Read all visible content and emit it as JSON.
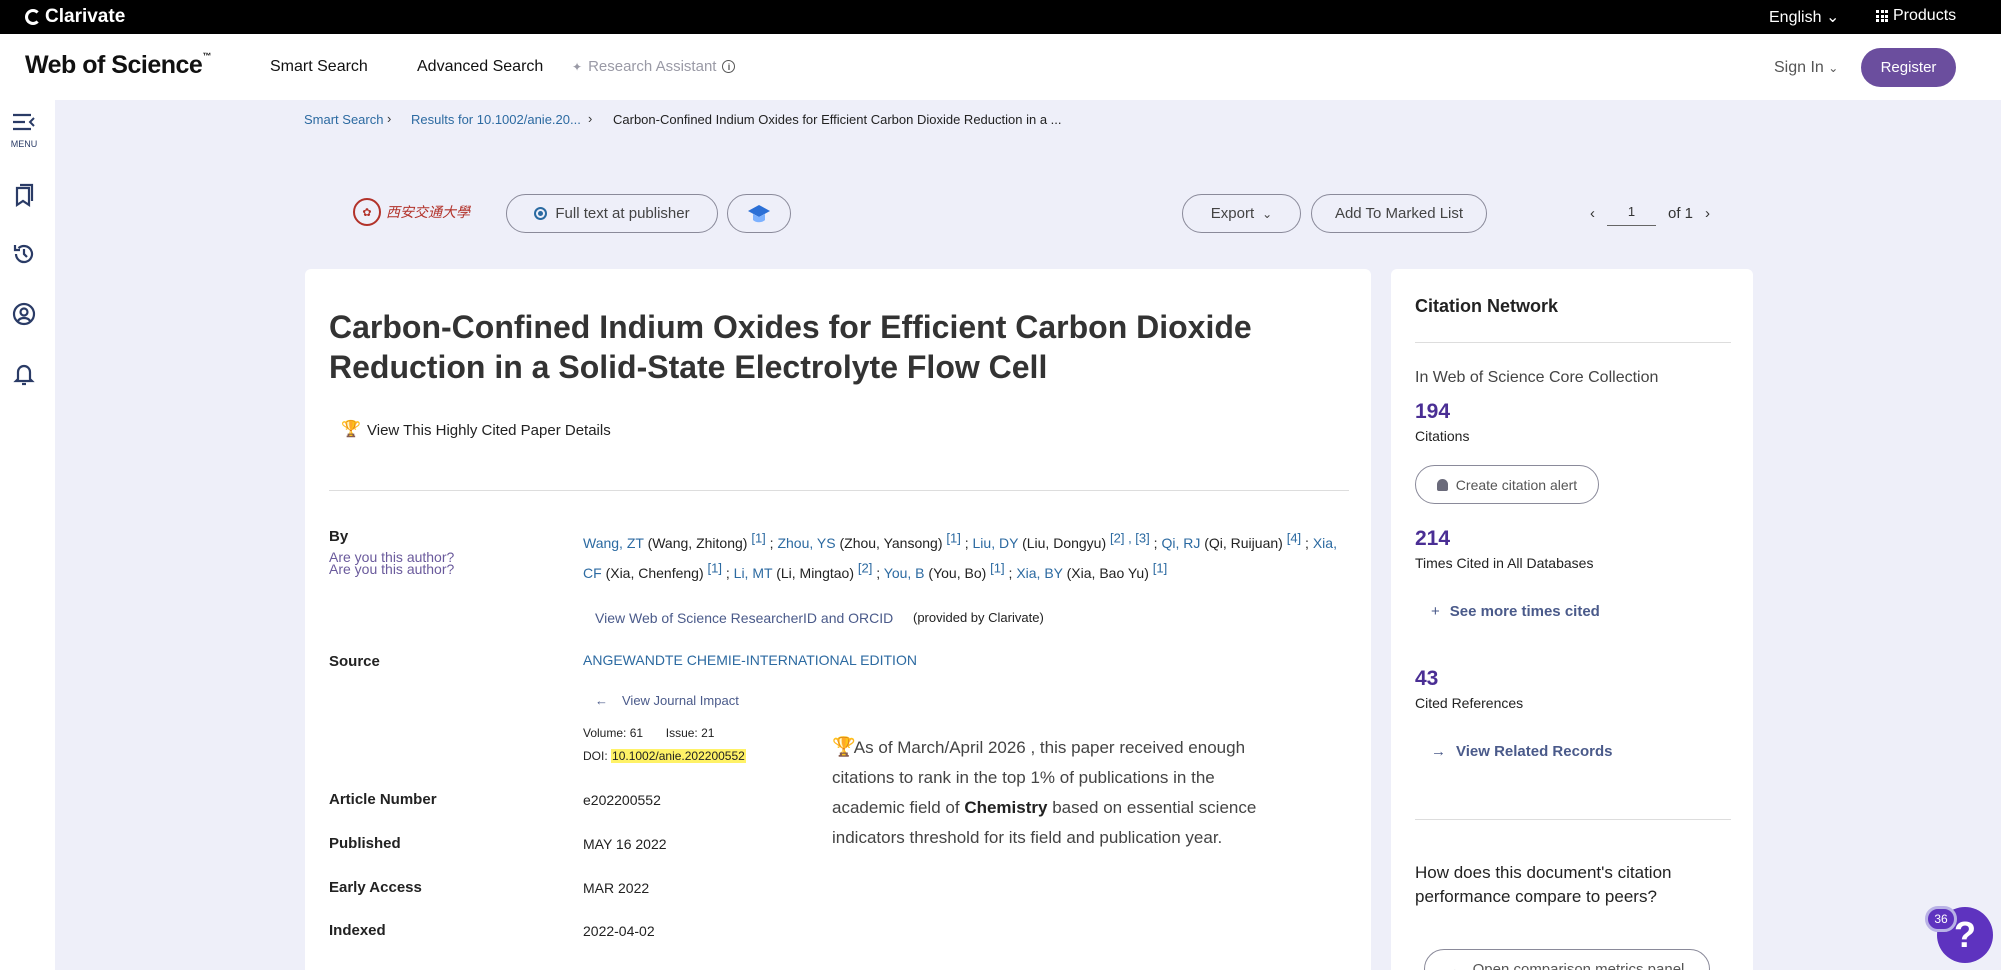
{
  "topbar": {
    "brand": "Clarivate",
    "language": "English",
    "products": "Products"
  },
  "header": {
    "logo": "Web of Science",
    "logo_tm": "™",
    "nav": [
      "Smart Search",
      "Advanced Search"
    ],
    "research_assistant": "Research Assistant",
    "sign_in": "Sign In",
    "register": "Register"
  },
  "sidebar": {
    "menu_label": "MENU",
    "icons": [
      "menu-icon",
      "marked-list-icon",
      "history-icon",
      "profile-icon",
      "alerts-icon"
    ]
  },
  "breadcrumb": {
    "items": [
      "Smart Search",
      "Results for 10.1002/anie.20...",
      "Carbon-Confined Indium Oxides for Efficient Carbon Dioxide Reduction in a ..."
    ]
  },
  "actions": {
    "institution_logo": "西安交通大學",
    "full_text": "Full text at publisher",
    "export": "Export",
    "add_marked": "Add To Marked List",
    "page_current": "1",
    "page_total": "of 1"
  },
  "record": {
    "title": "Carbon-Confined Indium Oxides for Efficient Carbon Dioxide Reduction in a Solid-State Electrolyte Flow Cell",
    "highly_cited_link": "View This Highly Cited Paper Details",
    "by_label": "By",
    "are_you_author": "Are you this author?",
    "authors": [
      {
        "short": "Wang, ZT",
        "full": "(Wang, Zhitong)",
        "aff": "[1]"
      },
      {
        "short": "Zhou, YS",
        "full": "(Zhou, Yansong)",
        "aff": "[1]"
      },
      {
        "short": "Liu, DY",
        "full": "(Liu, Dongyu)",
        "aff": "[2] , [3]"
      },
      {
        "short": "Qi, RJ",
        "full": "(Qi, Ruijuan)",
        "aff": "[4]"
      },
      {
        "short": "Xia, CF",
        "full": "(Xia, Chenfeng)",
        "aff": "[1]"
      },
      {
        "short": "Li, MT",
        "full": "(Li, Mingtao)",
        "aff": "[2]"
      },
      {
        "short": "You, B",
        "full": "(You, Bo)",
        "aff": "[1]"
      },
      {
        "short": "Xia, BY",
        "full": "(Xia, Bao Yu)",
        "aff": "[1]"
      }
    ],
    "researcher_id_link": "View Web of Science ResearcherID and ORCID",
    "provided_by": "(provided by Clarivate)",
    "source_label": "Source",
    "source": "ANGEWANDTE CHEMIE-INTERNATIONAL EDITION",
    "journal_impact": "View Journal Impact",
    "volume": "Volume: 61",
    "issue": "Issue: 21",
    "doi_label": "DOI:",
    "doi": "10.1002/anie.202200552",
    "article_number_label": "Article Number",
    "article_number": "e202200552",
    "published_label": "Published",
    "published": "MAY 16 2022",
    "early_access_label": "Early Access",
    "early_access": "MAR 2022",
    "indexed_label": "Indexed",
    "indexed": "2022-04-02",
    "hc_note_pre": "As of March/April 2026 , this paper received enough citations to rank in the top 1% of publications in the academic field of",
    "hc_note_field": "Chemistry",
    "hc_note_post": "based on essential science indicators threshold for its field and publication year."
  },
  "citation_network": {
    "title": "Citation Network",
    "collection": "In Web of Science Core Collection",
    "citations": "194",
    "citations_label": "Citations",
    "create_alert": "Create citation alert",
    "times_cited_all": "214",
    "times_cited_all_label": "Times Cited in All Databases",
    "see_more": "See more times cited",
    "cited_refs": "43",
    "cited_refs_label": "Cited References",
    "view_related": "View Related Records",
    "compare_question": "How does this document's citation performance compare to peers?",
    "compare_button": "Open comparison metrics panel"
  },
  "help": {
    "badge": "36",
    "symbol": "?"
  }
}
